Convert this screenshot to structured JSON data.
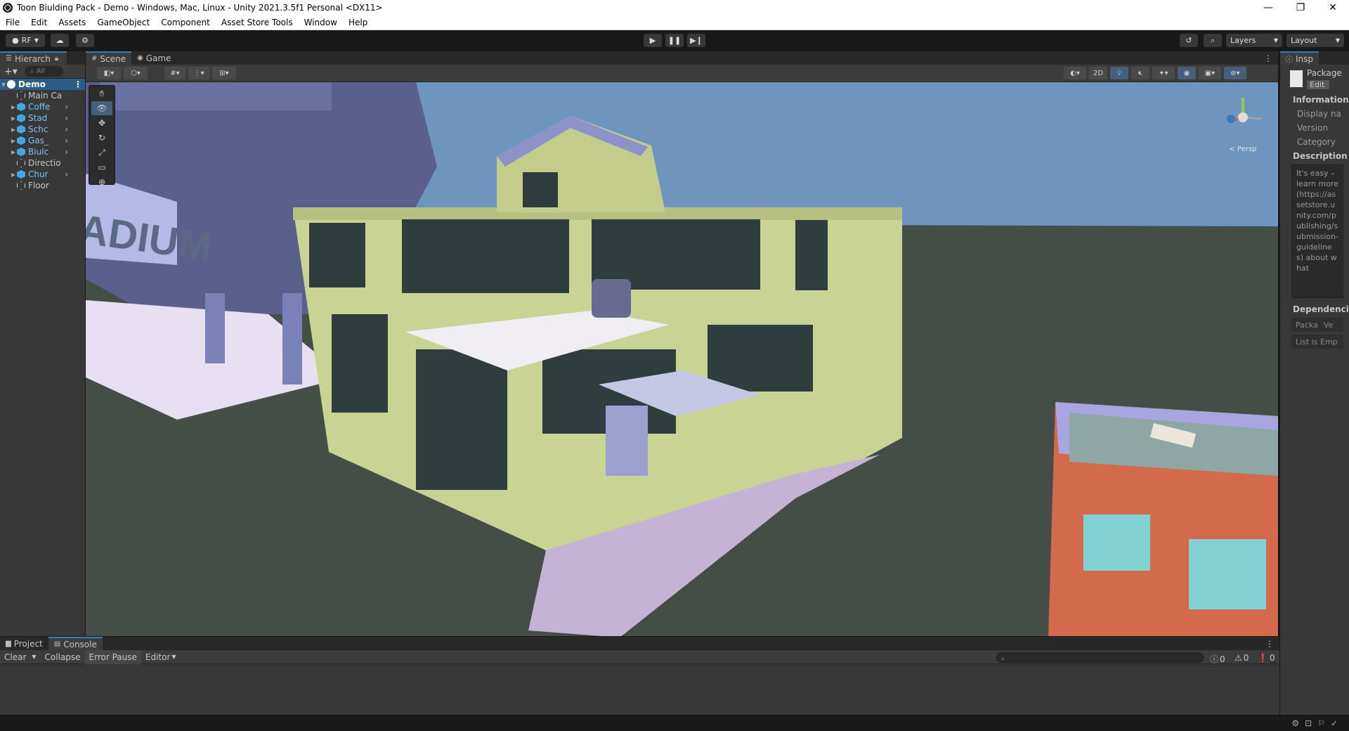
{
  "window": {
    "title": "Toon Biulding Pack - Demo - Windows, Mac, Linux - Unity 2021.3.5f1 Personal <DX11>",
    "controls": [
      "—",
      "❐",
      "✕"
    ]
  },
  "menu": [
    "File",
    "Edit",
    "Assets",
    "GameObject",
    "Component",
    "Asset Store Tools",
    "Window",
    "Help"
  ],
  "toolbar": {
    "account": "RF",
    "layers_label": "Layers",
    "layout_label": "Layout"
  },
  "hierarchy": {
    "tab_label": "Hierarch",
    "search_placeholder": "All",
    "scene_name": "Demo",
    "items": [
      {
        "label": "Main Ca",
        "prefab": false,
        "children": false
      },
      {
        "label": "Coffe",
        "prefab": true,
        "children": true
      },
      {
        "label": "Stad",
        "prefab": true,
        "children": true
      },
      {
        "label": "Schc",
        "prefab": true,
        "children": true
      },
      {
        "label": "Gas_",
        "prefab": true,
        "children": true
      },
      {
        "label": "Biulc",
        "prefab": true,
        "children": true
      },
      {
        "label": "Directio",
        "prefab": false,
        "children": false
      },
      {
        "label": "Chur",
        "prefab": true,
        "children": true
      },
      {
        "label": "Floor",
        "prefab": false,
        "children": false
      }
    ]
  },
  "scene_tabs": [
    {
      "label": "Scene",
      "active": true,
      "icon": "#"
    },
    {
      "label": "Game",
      "active": false,
      "icon": "◉"
    }
  ],
  "scene_toolbar": {
    "mode_2d": "2D",
    "gizmo_label": "< Persp"
  },
  "scene_content": {
    "billboard_text": "ADIUM"
  },
  "inspector": {
    "tab_label": "Insp",
    "object_name": "Package",
    "edit_button": "Edit",
    "information_header": "Information",
    "fields": [
      "Display na",
      "Version",
      "Category"
    ],
    "description_header": "Description",
    "description_text": "It's easy – learn more (https://assetstore.unity.com/publishing/submission-guidelines) about what",
    "dependencies_header": "Dependencie",
    "dep_columns": [
      "Packa",
      "Ve"
    ],
    "dep_empty": "List is Emp"
  },
  "bottom_tabs": [
    {
      "label": "Project",
      "active": false
    },
    {
      "label": "Console",
      "active": true
    }
  ],
  "console": {
    "clear": "Clear",
    "collapse": "Collapse",
    "error_pause": "Error Pause",
    "editor": "Editor",
    "info_count": "0",
    "warn_count": "0",
    "error_count": "0"
  }
}
